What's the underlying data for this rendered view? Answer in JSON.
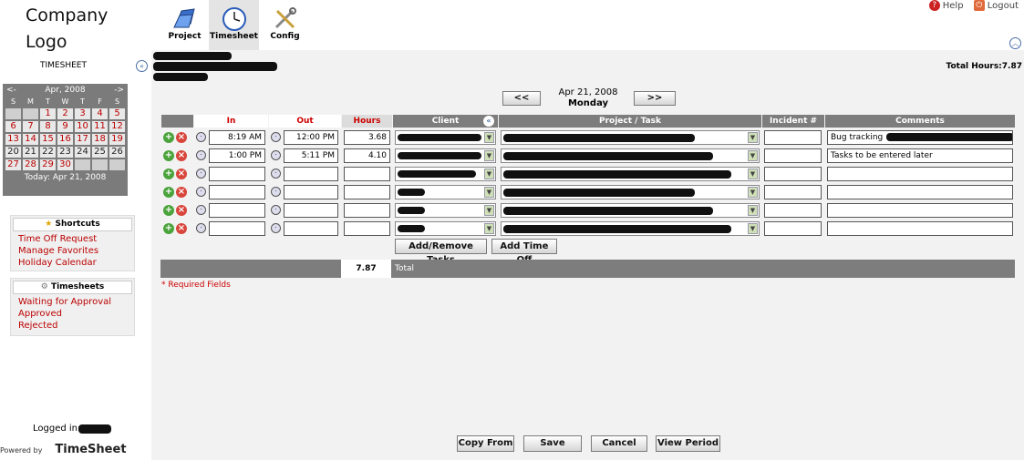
{
  "header": {
    "logo_line1": "Company",
    "logo_line2": "Logo",
    "nav_tabs": [
      {
        "label": "Project",
        "icon": "folder-icon"
      },
      {
        "label": "Timesheet",
        "icon": "clock-icon"
      },
      {
        "label": "Config",
        "icon": "tools-icon"
      }
    ],
    "help_label": "Help",
    "logout_label": "Logout"
  },
  "sidebar": {
    "title": "TIMESHEET",
    "calendar": {
      "prev": "<-",
      "next": "->",
      "month": "Apr, 2008",
      "dow": [
        "S",
        "M",
        "T",
        "W",
        "T",
        "F",
        "S"
      ],
      "days": [
        [
          "",
          "",
          "1",
          "2",
          "3",
          "4",
          "5"
        ],
        [
          "6",
          "7",
          "8",
          "9",
          "10",
          "11",
          "12"
        ],
        [
          "13",
          "14",
          "15",
          "16",
          "17",
          "18",
          "19"
        ],
        [
          "20",
          "21",
          "22",
          "23",
          "24",
          "25",
          "26"
        ],
        [
          "27",
          "28",
          "29",
          "30",
          "",
          "",
          ""
        ]
      ],
      "today": "Today: Apr 21, 2008"
    },
    "shortcuts": {
      "title": "Shortcuts",
      "items": [
        "Time Off Request",
        "Manage Favorites",
        "Holiday Calendar"
      ]
    },
    "timesheets": {
      "title": "Timesheets",
      "items": [
        "Waiting for Approval",
        "Approved",
        "Rejected"
      ]
    },
    "logged_in": "Logged in:",
    "powered_by": "Powered by",
    "powered_brand": "TimeSheet"
  },
  "main": {
    "total_hours": "Total Hours:7.87",
    "prev_btn": "<<",
    "next_btn": ">>",
    "date": "Apr 21, 2008",
    "weekday": "Monday",
    "columns": [
      "In",
      "Out",
      "Hours",
      "Client",
      "Project / Task",
      "Incident #",
      "Comments"
    ],
    "rows": [
      {
        "in": "8:19 AM",
        "out": "12:00 PM",
        "hours": "3.68",
        "comment": "Bug tracking"
      },
      {
        "in": "1:00 PM",
        "out": "5:11 PM",
        "hours": "4.10",
        "comment": "Tasks to be entered later"
      },
      {
        "in": "",
        "out": "",
        "hours": "",
        "comment": ""
      },
      {
        "in": "",
        "out": "",
        "hours": "",
        "comment": ""
      },
      {
        "in": "",
        "out": "",
        "hours": "",
        "comment": ""
      },
      {
        "in": "",
        "out": "",
        "hours": "",
        "comment": ""
      }
    ],
    "add_remove_tasks": "Add/Remove Tasks",
    "add_time_off": "Add Time Off",
    "total_value": "7.87",
    "total_label": "Total",
    "required_note": "Required Fields",
    "actions": [
      "Copy From",
      "Save",
      "Cancel",
      "View Period"
    ]
  }
}
